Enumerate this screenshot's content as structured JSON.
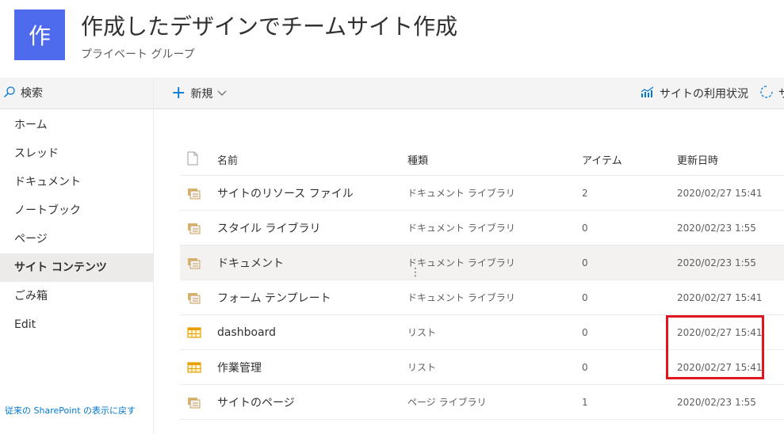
{
  "site": {
    "logo_char": "作",
    "title": "作成したデザインでチームサイト作成",
    "subtitle": "プライベート グループ",
    "logo_color": "#4f6bed"
  },
  "search": {
    "placeholder": "検索"
  },
  "nav": {
    "items": [
      {
        "label": "ホーム"
      },
      {
        "label": "スレッド"
      },
      {
        "label": "ドキュメント"
      },
      {
        "label": "ノートブック"
      },
      {
        "label": "ページ"
      },
      {
        "label": "サイト コンテンツ",
        "active": true
      },
      {
        "label": "ごみ箱"
      },
      {
        "label": "Edit"
      }
    ],
    "footer_link": "従来の SharePoint の表示に戻す"
  },
  "commandbar": {
    "new_label": "新規",
    "usage_label": "サイトの利用状況",
    "recycle_label": "サ"
  },
  "table": {
    "headers": {
      "name": "名前",
      "type": "種類",
      "items": "アイテム",
      "modified": "更新日時"
    },
    "rows": [
      {
        "icon": "library-icon",
        "name": "サイトのリソース ファイル",
        "type": "ドキュメント ライブラリ",
        "items": "2",
        "modified": "2020/02/27 15:41"
      },
      {
        "icon": "library-icon",
        "name": "スタイル ライブラリ",
        "type": "ドキュメント ライブラリ",
        "items": "0",
        "modified": "2020/02/23 1:55"
      },
      {
        "icon": "library-icon",
        "name": "ドキュメント",
        "type": "ドキュメント ライブラリ",
        "items": "0",
        "modified": "2020/02/23 1:55",
        "hover": true
      },
      {
        "icon": "library-icon",
        "name": "フォーム テンプレート",
        "type": "ドキュメント ライブラリ",
        "items": "0",
        "modified": "2020/02/27 15:41"
      },
      {
        "icon": "list-icon",
        "name": "dashboard",
        "type": "リスト",
        "items": "0",
        "modified": "2020/02/27 15:41"
      },
      {
        "icon": "list-icon",
        "name": "作業管理",
        "type": "リスト",
        "items": "0",
        "modified": "2020/02/27 15:41"
      },
      {
        "icon": "library-icon",
        "name": "サイトのページ",
        "type": "ページ ライブラリ",
        "items": "1",
        "modified": "2020/02/23 1:55"
      }
    ]
  },
  "colors": {
    "accent": "#0078d4",
    "highlight": "#e0161f",
    "library_icon": "#c8a05a",
    "list_icon": "#e8a000"
  }
}
